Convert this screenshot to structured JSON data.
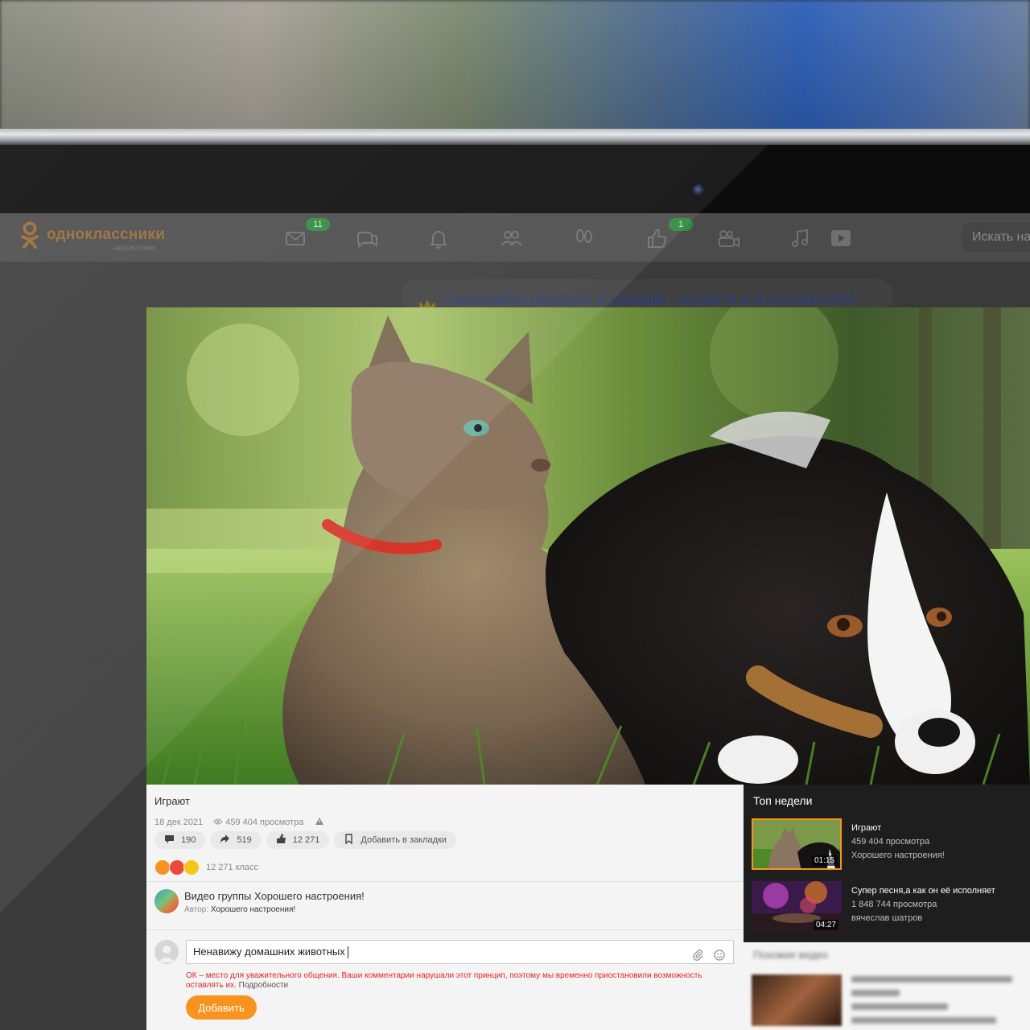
{
  "site": {
    "logo_text": "одноклассники",
    "logo_sub": "экосистема",
    "mail_badge": "11",
    "likes_badge": "1",
    "search_placeholder": "Искать на",
    "promo_text": "Собирайте ресурсы и урожай - играйте в Королевство!"
  },
  "video": {
    "title": "Играют",
    "date": "18 дек 2021",
    "views": "459 404 просмотра",
    "comments": "190",
    "shares": "519",
    "likes": "12 271",
    "bookmark_label": "Добавить в закладки",
    "reaction_count": "12 271 класс"
  },
  "group": {
    "title": "Видео группы Хорошего настроения!",
    "author_label": "Автор:",
    "author_name": "Хорошего настроения!"
  },
  "comment": {
    "value": "Ненавижу домашних животных",
    "violation": "ОК – место для уважительного общения. Ваши комментарии нарушали этот принцип, поэтому мы временно приостановили возможность оставлять их.",
    "details_link": "Подробности",
    "submit_label": "Добавить"
  },
  "sidebar": {
    "top_title": "Топ недели",
    "items": [
      {
        "title": "Играют",
        "views": "459 404 просмотра",
        "author": "Хорошего настроения!",
        "duration": "01:15"
      },
      {
        "title": "Супер песня,а как он её исполняет",
        "views": "1 848 744 просмотра",
        "author": "вячеслав шатров",
        "duration": "04:27"
      }
    ],
    "similar_title": "Похожие видео"
  },
  "colors": {
    "accent": "#f7931e",
    "error": "#e0242b",
    "badge": "#2f8a3e",
    "sidebar_bg": "#1e1e1e"
  }
}
